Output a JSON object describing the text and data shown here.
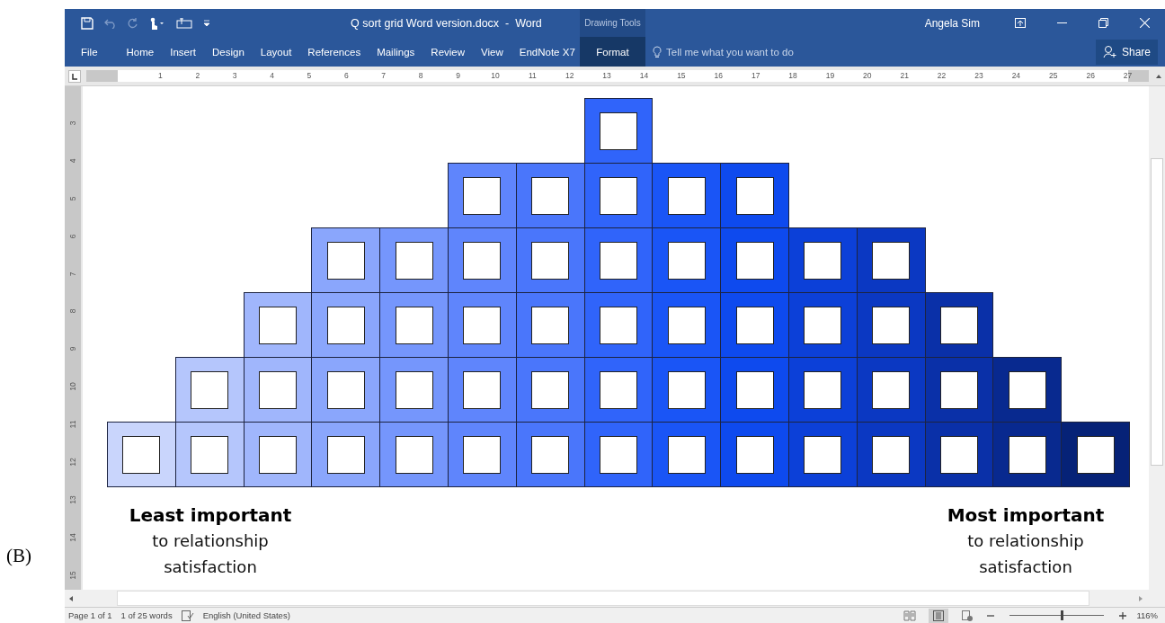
{
  "figure_label": "(B)",
  "window": {
    "title": "Q sort grid Word version.docx  -  Word",
    "contextual_group": "Drawing Tools",
    "user": "Angela Sim"
  },
  "tabs": [
    {
      "label": "File",
      "selected": false
    },
    {
      "label": "Home",
      "selected": false
    },
    {
      "label": "Insert",
      "selected": false
    },
    {
      "label": "Design",
      "selected": false
    },
    {
      "label": "Layout",
      "selected": false
    },
    {
      "label": "References",
      "selected": false
    },
    {
      "label": "Mailings",
      "selected": false
    },
    {
      "label": "Review",
      "selected": false
    },
    {
      "label": "View",
      "selected": false
    },
    {
      "label": "EndNote X7",
      "selected": false
    }
  ],
  "contextual_tab": {
    "label": "Format",
    "selected": true
  },
  "tell_me": {
    "placeholder": "Tell me what you want to do"
  },
  "share_button": "Share",
  "ruler": {
    "horizontal": [
      "1",
      "2",
      "3",
      "4",
      "5",
      "6",
      "7",
      "8",
      "9",
      "10",
      "11",
      "12",
      "13",
      "14",
      "15",
      "16",
      "17",
      "18",
      "19",
      "20",
      "21",
      "22",
      "23",
      "24",
      "25",
      "26",
      "27"
    ],
    "vertical": [
      "3",
      "4",
      "5",
      "6",
      "7",
      "8",
      "9",
      "10",
      "11",
      "12",
      "13",
      "14",
      "15"
    ]
  },
  "grid": {
    "columns": [
      {
        "color": "#c9d5fc",
        "cells": [
          {
            "kind": "slot"
          }
        ]
      },
      {
        "color": "#b5c6fc",
        "cells": [
          {
            "kind": "slot"
          },
          {
            "kind": "slot"
          }
        ]
      },
      {
        "color": "#a0b6fc",
        "cells": [
          {
            "kind": "slot"
          },
          {
            "kind": "slot"
          },
          {
            "kind": "slot"
          }
        ]
      },
      {
        "color": "#8aa6fc",
        "cells": [
          {
            "kind": "slot"
          },
          {
            "kind": "slot"
          },
          {
            "kind": "slot"
          },
          {
            "kind": "slot"
          }
        ]
      },
      {
        "color": "#7596fc",
        "cells": [
          {
            "kind": "slot"
          },
          {
            "kind": "slot"
          },
          {
            "kind": "slot"
          },
          {
            "kind": "slot"
          }
        ]
      },
      {
        "color": "#5f85fc",
        "cells": [
          {
            "kind": "slot"
          },
          {
            "kind": "slot"
          },
          {
            "kind": "slot"
          },
          {
            "kind": "slot"
          },
          {
            "kind": "slot"
          }
        ]
      },
      {
        "color": "#4a76fb",
        "cells": [
          {
            "kind": "slot"
          },
          {
            "kind": "slot"
          },
          {
            "kind": "slot"
          },
          {
            "kind": "slot"
          },
          {
            "kind": "slot"
          }
        ]
      },
      {
        "color": "#3064fa",
        "cells": [
          {
            "kind": "slot"
          },
          {
            "kind": "slot"
          },
          {
            "kind": "slot"
          },
          {
            "kind": "slot"
          },
          {
            "kind": "slot"
          },
          {
            "kind": "slot"
          }
        ]
      },
      {
        "color": "#1a55f6",
        "cells": [
          {
            "kind": "slot"
          },
          {
            "kind": "slot"
          },
          {
            "kind": "slot"
          },
          {
            "kind": "slot"
          },
          {
            "kind": "slot"
          }
        ]
      },
      {
        "color": "#0e4aee",
        "cells": [
          {
            "kind": "slot"
          },
          {
            "kind": "slot"
          },
          {
            "kind": "slot"
          },
          {
            "kind": "slot"
          },
          {
            "kind": "slot"
          }
        ]
      },
      {
        "color": "#0c40d8",
        "cells": [
          {
            "kind": "slot"
          },
          {
            "kind": "slot"
          },
          {
            "kind": "slot"
          },
          {
            "kind": "slot"
          }
        ]
      },
      {
        "color": "#0b38c2",
        "cells": [
          {
            "kind": "slot"
          },
          {
            "kind": "slot"
          },
          {
            "kind": "slot"
          },
          {
            "kind": "slot"
          }
        ]
      },
      {
        "color": "#0a30a8",
        "cells": [
          {
            "kind": "slot"
          },
          {
            "kind": "slot"
          },
          {
            "kind": "slot"
          }
        ]
      },
      {
        "color": "#08298f",
        "cells": [
          {
            "kind": "slot"
          },
          {
            "kind": "slot"
          }
        ]
      },
      {
        "color": "#062277",
        "cells": [
          {
            "kind": "slot"
          }
        ]
      }
    ]
  },
  "captions": [
    {
      "title": "Least important",
      "subtitle": "to relationship satisfaction"
    },
    {
      "title": "Most important",
      "subtitle": "to relationship satisfaction"
    }
  ],
  "status_bar": {
    "page": "Page 1 of 1",
    "words": "1 of 25 words",
    "language": "English (United States)",
    "views": [
      {
        "kind": "read",
        "selected": false
      },
      {
        "kind": "print",
        "selected": true
      },
      {
        "kind": "web",
        "selected": false
      }
    ],
    "zoom": {
      "level": 0.55,
      "reading": "116%"
    }
  }
}
